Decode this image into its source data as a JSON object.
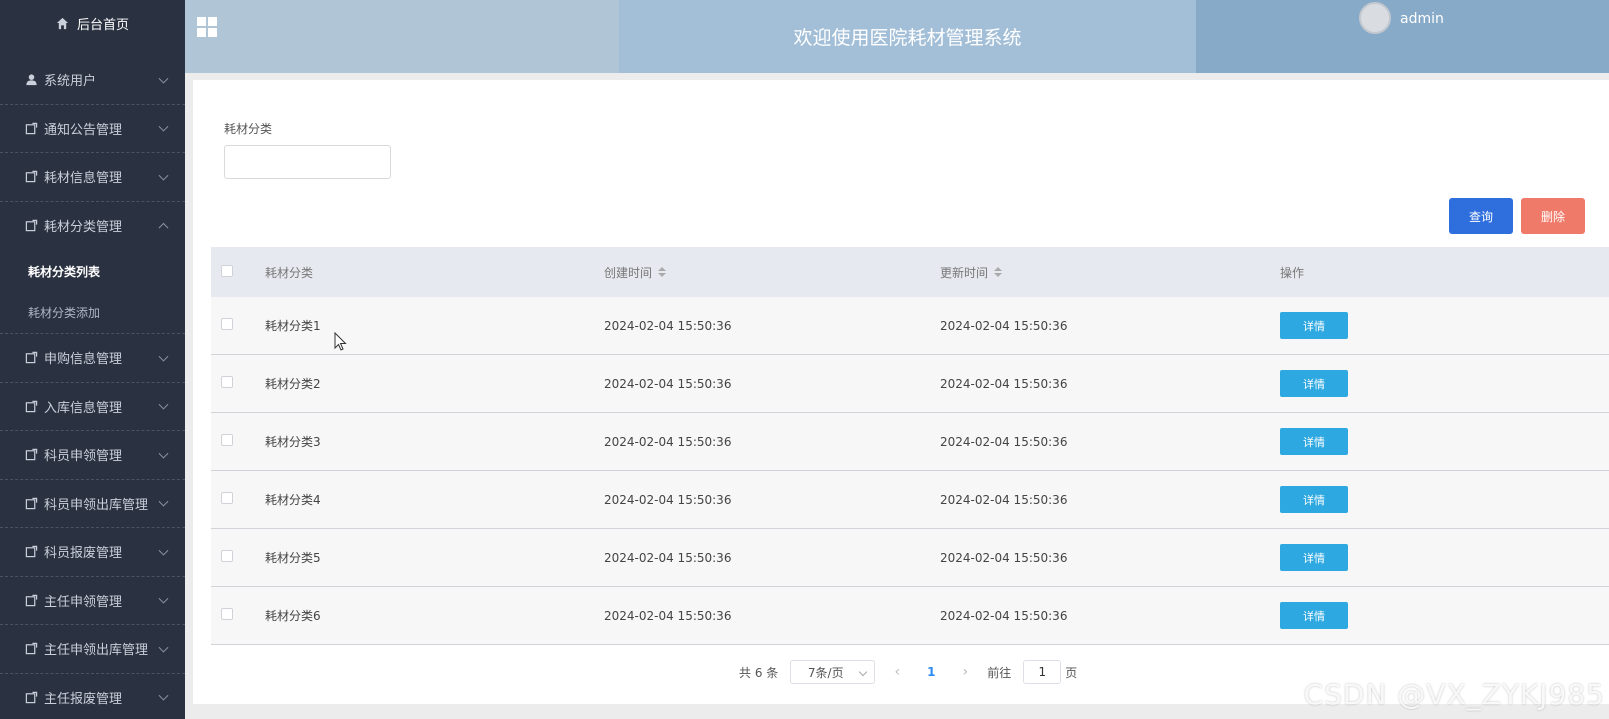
{
  "sidebar": {
    "home_label": "后台首页",
    "items": [
      {
        "label": "系统用户",
        "expanded": false
      },
      {
        "label": "通知公告管理",
        "expanded": false
      },
      {
        "label": "耗材信息管理",
        "expanded": false
      },
      {
        "label": "耗材分类管理",
        "expanded": true
      },
      {
        "label": "申购信息管理",
        "expanded": false
      },
      {
        "label": "入库信息管理",
        "expanded": false
      },
      {
        "label": "科员申领管理",
        "expanded": false
      },
      {
        "label": "科员申领出库管理",
        "expanded": false
      },
      {
        "label": "科员报废管理",
        "expanded": false
      },
      {
        "label": "主任申领管理",
        "expanded": false
      },
      {
        "label": "主任申领出库管理",
        "expanded": false
      },
      {
        "label": "主任报废管理",
        "expanded": false
      }
    ],
    "sub_items": [
      {
        "label": "耗材分类列表",
        "active": true
      },
      {
        "label": "耗材分类添加",
        "active": false
      }
    ]
  },
  "header": {
    "title": "欢迎使用医院耗材管理系统",
    "username": "admin"
  },
  "search": {
    "label": "耗材分类",
    "value": ""
  },
  "buttons": {
    "query": "查询",
    "delete": "删除"
  },
  "table": {
    "headers": [
      "耗材分类",
      "创建时间",
      "更新时间",
      "操作"
    ],
    "detail_label": "详情",
    "rows": [
      {
        "name": "耗材分类1",
        "created": "2024-02-04 15:50:36",
        "updated": "2024-02-04 15:50:36"
      },
      {
        "name": "耗材分类2",
        "created": "2024-02-04 15:50:36",
        "updated": "2024-02-04 15:50:36"
      },
      {
        "name": "耗材分类3",
        "created": "2024-02-04 15:50:36",
        "updated": "2024-02-04 15:50:36"
      },
      {
        "name": "耗材分类4",
        "created": "2024-02-04 15:50:36",
        "updated": "2024-02-04 15:50:36"
      },
      {
        "name": "耗材分类5",
        "created": "2024-02-04 15:50:36",
        "updated": "2024-02-04 15:50:36"
      },
      {
        "name": "耗材分类6",
        "created": "2024-02-04 15:50:36",
        "updated": "2024-02-04 15:50:36"
      }
    ]
  },
  "pagination": {
    "total_text": "共 6 条",
    "page_size": "7条/页",
    "prev": "‹",
    "current": "1",
    "next": "›",
    "goto_prefix": "前往",
    "goto_value": "1",
    "goto_suffix": "页"
  },
  "watermark": "CSDN @VX_ZYKJ985",
  "colors": {
    "sidebar_bg": "#2a3140",
    "query_button": "#2f6fdd",
    "delete_button": "#f07a6a",
    "detail_button": "#2ea8e0"
  }
}
